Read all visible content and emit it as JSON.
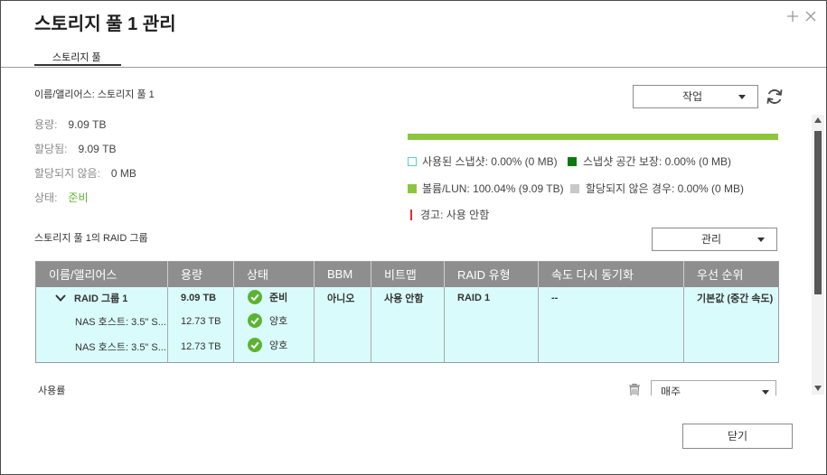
{
  "dialog": {
    "title": "스토리지 풀 1 관리"
  },
  "tabs": [
    {
      "label": "스토리지 풀",
      "active": true
    }
  ],
  "pool": {
    "name_label": "이름/앨리어스:",
    "name_value": "스토리지 풀 1",
    "fields": [
      {
        "label": "용량:",
        "value": "9.09 TB"
      },
      {
        "label": "할당됨:",
        "value": "9.09 TB"
      },
      {
        "label": "할당되지 않음:",
        "value": "0 MB"
      },
      {
        "label": "상태:",
        "value": "준비"
      }
    ],
    "action_button": "작업"
  },
  "usage_bar": {
    "fill_percent": 100,
    "legend": [
      {
        "label": "사용된 스냅샷: 0.00% (0 MB)",
        "color": "#55cfcf"
      },
      {
        "label": "스냅샷 공간 보장: 0.00% (0 MB)",
        "color": "#0c7a10"
      },
      {
        "label": "볼륨/LUN: 100.04% (9.09 TB)",
        "color": "#8cc63f"
      },
      {
        "label": "할당되지 않은 경우: 0.00% (0 MB)",
        "color": "#c8c8c8"
      },
      {
        "label": "경고: 사용 안함",
        "color": "#e2322f"
      }
    ]
  },
  "raid": {
    "heading": "스토리지 풀 1의 RAID 그룹",
    "manage_button": "관리",
    "columns": [
      "이름/앨리어스",
      "용량",
      "상태",
      "BBM",
      "비트맵",
      "RAID 유형",
      "속도 다시 동기화",
      "우선 순위"
    ],
    "rows": [
      {
        "name": "RAID 그룹 1",
        "capacity": "9.09 TB",
        "status": "준비",
        "bbm": "아니오",
        "bitmap": "사용 안함",
        "raid_type": "RAID 1",
        "resync": "--",
        "priority": "기본값 (중간 속도)"
      },
      {
        "name": "NAS 호스트: 3.5\" S...",
        "capacity": "12.73 TB",
        "status": "양호"
      },
      {
        "name": "NAS 호스트: 3.5\" S...",
        "capacity": "12.73 TB",
        "status": "양호"
      }
    ]
  },
  "utilization": {
    "label": "사용률",
    "period_select": "매주"
  },
  "footer": {
    "close_button": "닫기"
  },
  "colors": {
    "usage_fill": "#8cc63f",
    "status_ok": "#5bb431",
    "table_header_bg": "#8e8e8e",
    "table_body_bg": "#dafbfb",
    "warning_red": "#e2322f"
  },
  "icons": {
    "expand_window": "plus-icon",
    "close_window": "close-icon",
    "refresh": "refresh-icon",
    "row_expand": "chevron-down-icon",
    "status": "check-circle-icon",
    "delete": "trash-icon",
    "dropdown": "caret-down-icon"
  }
}
